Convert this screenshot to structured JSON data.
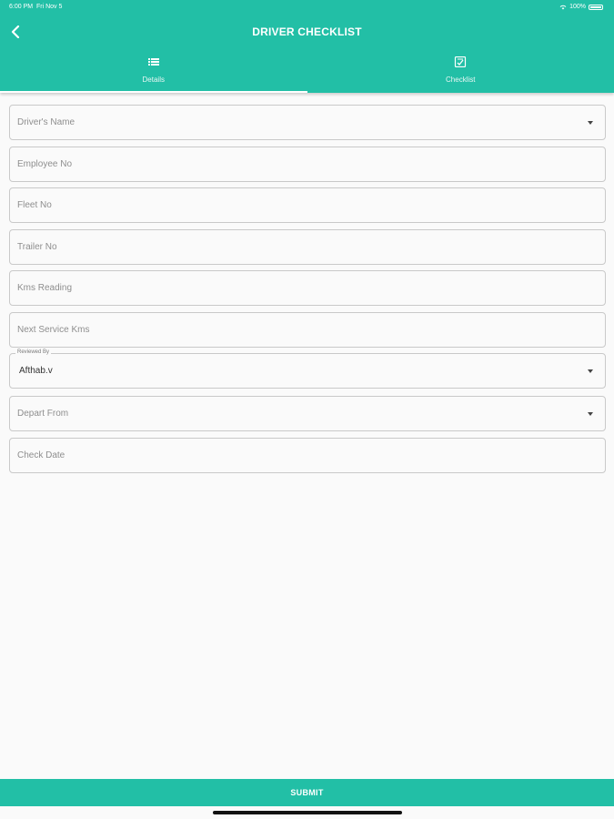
{
  "status_bar": {
    "time": "6:00 PM",
    "date": "Fri Nov 5",
    "battery": "100%"
  },
  "header": {
    "title": "DRIVER CHECKLIST",
    "back_icon": "chevron-left-icon"
  },
  "tabs": [
    {
      "label": "Details",
      "icon": "list-icon",
      "active": true
    },
    {
      "label": "Checklist",
      "icon": "checklist-icon",
      "active": false
    }
  ],
  "form": {
    "drivers_name": {
      "placeholder": "Driver's Name",
      "type": "select"
    },
    "employee_no": {
      "placeholder": "Employee No"
    },
    "fleet_no": {
      "placeholder": "Fleet No"
    },
    "trailer_no": {
      "placeholder": "Trailer No"
    },
    "kms_reading": {
      "placeholder": "Kms Reading"
    },
    "next_service_kms": {
      "placeholder": "Next Service Kms"
    },
    "reviewed_by": {
      "label": "Reviewed By",
      "value": "Afthab.v",
      "type": "select"
    },
    "depart_from": {
      "placeholder": "Depart From",
      "type": "select"
    },
    "check_date": {
      "placeholder": "Check Date"
    }
  },
  "footer": {
    "submit_label": "SUBMIT"
  },
  "colors": {
    "accent": "#22bfa6",
    "background": "#fafafa",
    "border": "#c9c9c9"
  }
}
